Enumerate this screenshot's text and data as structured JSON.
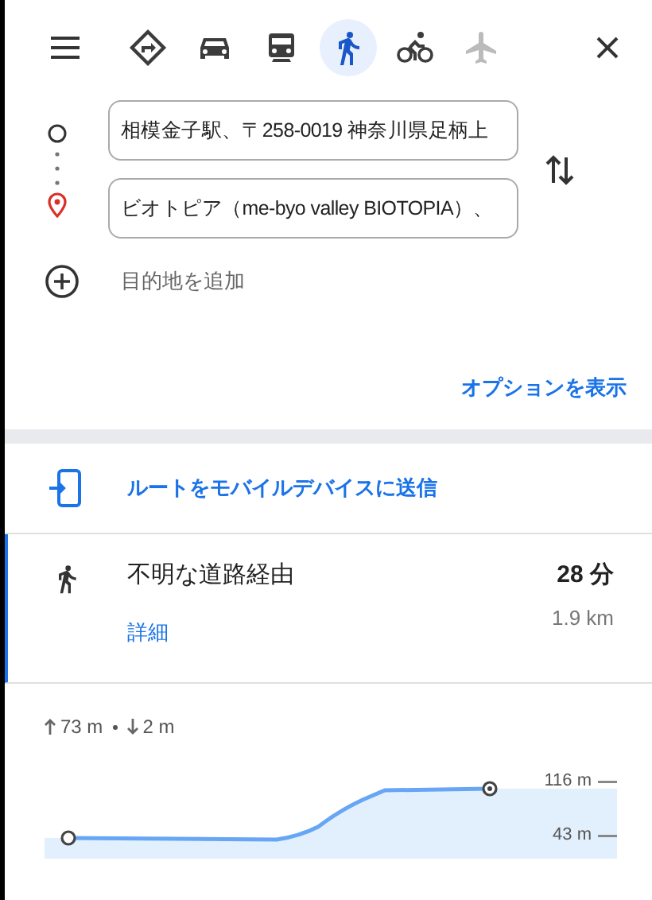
{
  "modes": [
    {
      "kind": "best",
      "selected": false,
      "disabled": false
    },
    {
      "kind": "car",
      "selected": false,
      "disabled": false
    },
    {
      "kind": "transit",
      "selected": false,
      "disabled": false
    },
    {
      "kind": "walk",
      "selected": true,
      "disabled": false
    },
    {
      "kind": "bike",
      "selected": false,
      "disabled": false
    },
    {
      "kind": "flight",
      "selected": false,
      "disabled": true
    }
  ],
  "origin": {
    "value": "相模金子駅、〒258-0019 神奈川県足柄上"
  },
  "destination": {
    "value": "ビオトピア（me-byo valley BIOTOPIA）、"
  },
  "add_destination": "目的地を追加",
  "options_link": "オプションを表示",
  "send_to_device": "ルートをモバイルデバイスに送信",
  "route": {
    "selected": true,
    "title": "不明な道路経由",
    "duration": "28 分",
    "distance": "1.9 km",
    "details_link": "詳細"
  },
  "elevation": {
    "summary_up": "73 m",
    "summary_down": "2 m",
    "max_label": "116 m",
    "min_label": "43 m"
  }
}
